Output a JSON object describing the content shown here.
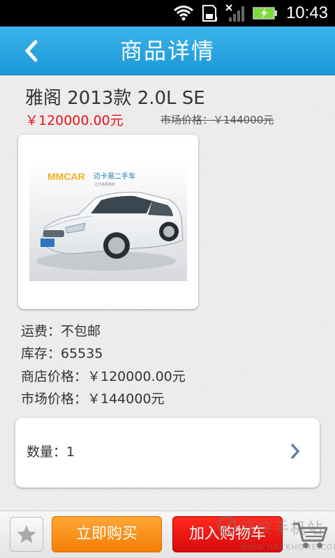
{
  "status_bar": {
    "time": "10:43",
    "icons": [
      "wifi-icon",
      "sd-card-icon",
      "no-signal-icon",
      "battery-charging-icon"
    ],
    "battery_color": "#7bdc3a"
  },
  "header": {
    "title": "商品详情",
    "back_icon": "chevron-left-icon",
    "bg_color": "#1c98d8"
  },
  "product": {
    "name": "雅阁 2013款 2.0L SE",
    "price": "￥120000.00元",
    "market_price_label": "市场价格：￥144000元",
    "image": {
      "brand": "MMCAR",
      "brand_cn": "迈卡易二手车",
      "tagline": "让交易更简单"
    }
  },
  "details": {
    "shipping": "运费：不包邮",
    "stock": "库存：65535",
    "shop_price": "商店价格：￥120000.00元",
    "market_price": "市场价格：￥144000元"
  },
  "quantity": {
    "label": "数量：1"
  },
  "actions": {
    "favorite_icon": "star-icon",
    "buy_now": "立即购买",
    "add_to_cart": "加入购物车",
    "cart_icon": "shopping-cart-icon"
  },
  "watermark": {
    "text": "网侠手机站",
    "url": "WWW.HACKHOME.COM"
  },
  "colors": {
    "price_red": "#e8111c",
    "buy_orange": "#f47e07",
    "cart_red": "#d90a0a"
  }
}
